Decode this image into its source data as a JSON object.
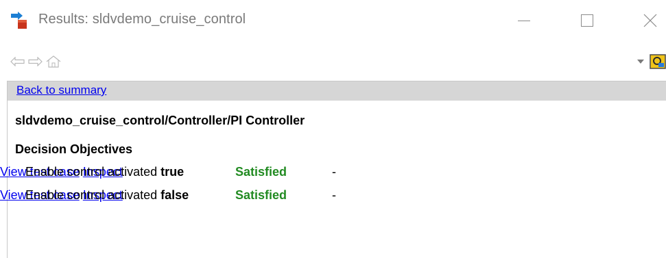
{
  "window": {
    "title": "Results: sldvdemo_cruise_control"
  },
  "toolbar": {
    "buttons": [
      {
        "name": "back-arrow-icon"
      },
      {
        "name": "forward-arrow-icon"
      },
      {
        "name": "home-icon"
      },
      {
        "name": "dropdown-caret-icon"
      },
      {
        "name": "locate-icon"
      }
    ]
  },
  "report": {
    "back_link": "Back to summary",
    "block_path": "sldvdemo_cruise_control/Controller/PI Controller",
    "section_title": "Decision Objectives",
    "objectives": [
      {
        "prefix": "Enable control activated ",
        "outcome": "true",
        "status": "Satisfied",
        "dash": "-",
        "view_link": "View test case",
        "inspect_link": "Inspect"
      },
      {
        "prefix": "Enable control activated ",
        "outcome": "false",
        "status": "Satisfied",
        "dash": "-",
        "view_link": "View test case",
        "inspect_link": "Inspect"
      }
    ]
  },
  "colors": {
    "status_satisfied": "#228b22",
    "link": "#0000ee",
    "summary_bar": "#d6d6d6",
    "title_text": "#7a7a7a"
  }
}
